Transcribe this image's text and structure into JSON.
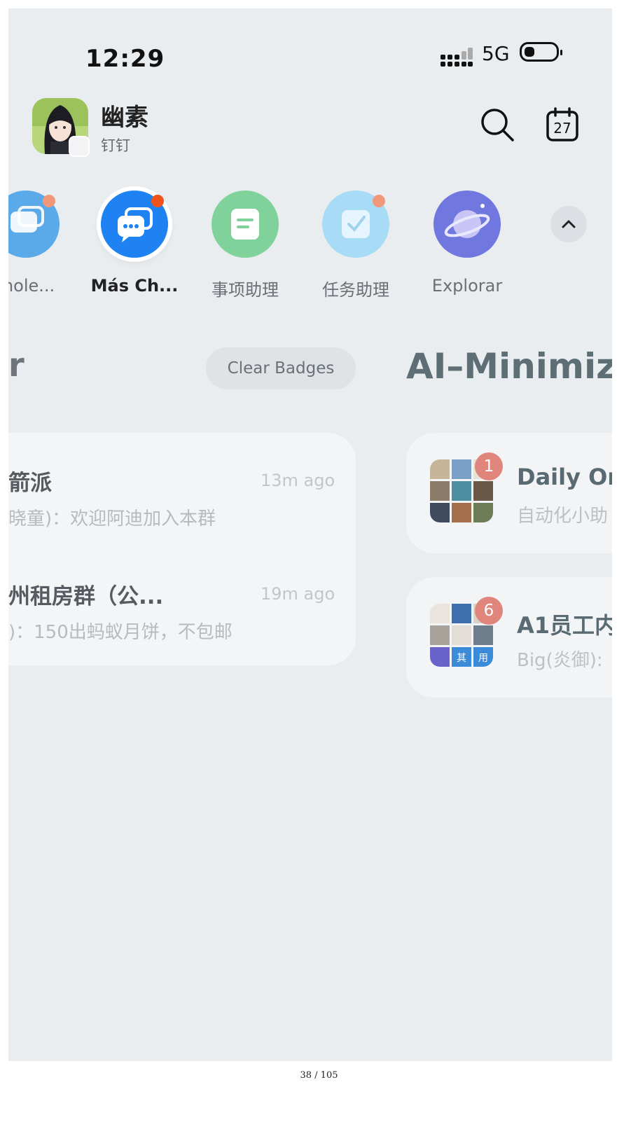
{
  "status_bar": {
    "time": "12:29",
    "network": "5G"
  },
  "header": {
    "user_name": "幽素",
    "org_name": "钉钉"
  },
  "calendar": {
    "day": "27"
  },
  "apps": [
    {
      "label": "mole...",
      "color": "#5aa9e8",
      "badge": true
    },
    {
      "label": "Más Ch...",
      "color": "#1f82f2",
      "badge": true
    },
    {
      "label": "事项助理",
      "color": "#7fd39a",
      "badge": false
    },
    {
      "label": "任务助理",
      "color": "#a8dcf6",
      "badge": true
    },
    {
      "label": "Explorar",
      "color": "#7078e0",
      "badge": false
    }
  ],
  "toolbar": {
    "clear_badges": "Clear Badges"
  },
  "section": {
    "left_fragment": "r",
    "title": "AI–Minimize"
  },
  "chats_left": [
    {
      "title": "箭派",
      "time": "13m ago",
      "preview": "晓童)：欢迎阿迪加入本群"
    },
    {
      "title": "州租房群（公...",
      "time": "19m ago",
      "preview": ")：150出蚂蚁月饼，不包邮"
    }
  ],
  "chats_right": [
    {
      "title": "Daily On",
      "preview": "自动化小助",
      "count": "1",
      "avatar_tags": []
    },
    {
      "title": "A1员工内",
      "preview": "Big(炎御):",
      "count": "6",
      "avatar_tags": [
        "其",
        "用"
      ]
    }
  ],
  "page_indicator": "38 / 105"
}
